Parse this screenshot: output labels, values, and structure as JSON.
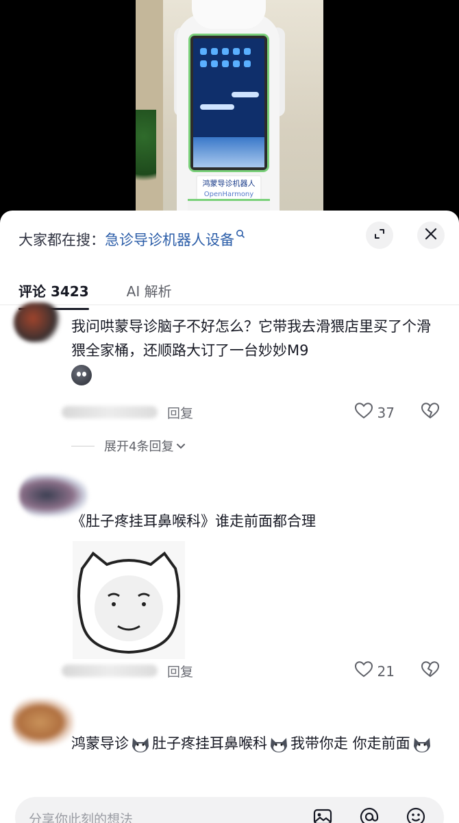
{
  "video": {
    "robot_label": "鸿蒙导诊机器人",
    "robot_sublabel": "OpenHarmony"
  },
  "search_hint": {
    "prefix": "大家都在搜：",
    "keyword": "急诊导诊机器人设备"
  },
  "tabs": [
    {
      "label": "评论 3423"
    },
    {
      "label": "AI 解析"
    }
  ],
  "comments": [
    {
      "text": "我问哄蒙导诊脑子不好怎么？它带我去滑猥店里买了个滑猥全家桶，还顺路大订了一台妙妙M9",
      "reply_label": "回复",
      "likes": "37",
      "expand_replies": "展开4条回复"
    },
    {
      "text": "《肚子疼挂耳鼻喉科》谁走前面都合理",
      "reply_label": "回复",
      "likes": "21"
    },
    {
      "text_parts": [
        "鸿蒙导诊",
        "肚子疼挂耳鼻喉科",
        "我带你走  你走前面"
      ]
    }
  ],
  "input_bar": {
    "placeholder": "分享你此刻的想法"
  },
  "icons": {
    "expand": "expand-icon",
    "close": "close-icon",
    "heart": "heart-icon",
    "broken_heart": "broken-heart-icon",
    "image": "image-icon",
    "mention": "at-icon",
    "emoji": "emoji-icon"
  },
  "colors": {
    "keyword": "#2b5da8",
    "text": "#161823",
    "muted": "#6c6e76"
  }
}
